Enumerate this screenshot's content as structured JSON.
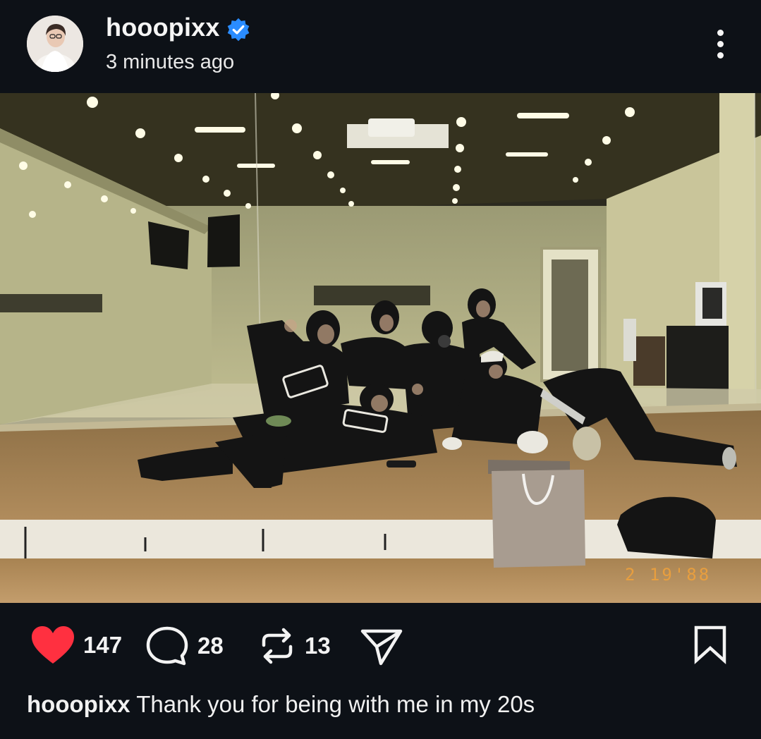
{
  "post": {
    "username": "hooopixx",
    "verified": true,
    "timestamp": "3 minutes ago",
    "photo_date_stamp": "2 19'88",
    "audio_muted": true
  },
  "actions": {
    "likes": "147",
    "comments": "28",
    "reposts": "13",
    "liked": true
  },
  "caption": {
    "username": "hooopixx",
    "text": "Thank you for being with me in my 20s"
  },
  "icons": {
    "verified": "verified-badge-icon",
    "more": "more-vertical-icon",
    "like": "heart-icon",
    "comment": "comment-bubble-icon",
    "repost": "repost-icon",
    "share": "send-icon",
    "save": "bookmark-icon",
    "mute": "speaker-muted-icon"
  },
  "colors": {
    "background": "#0d1117",
    "heart": "#ff3040",
    "verified": "#2a8cff",
    "text": "#f2f3f5"
  }
}
